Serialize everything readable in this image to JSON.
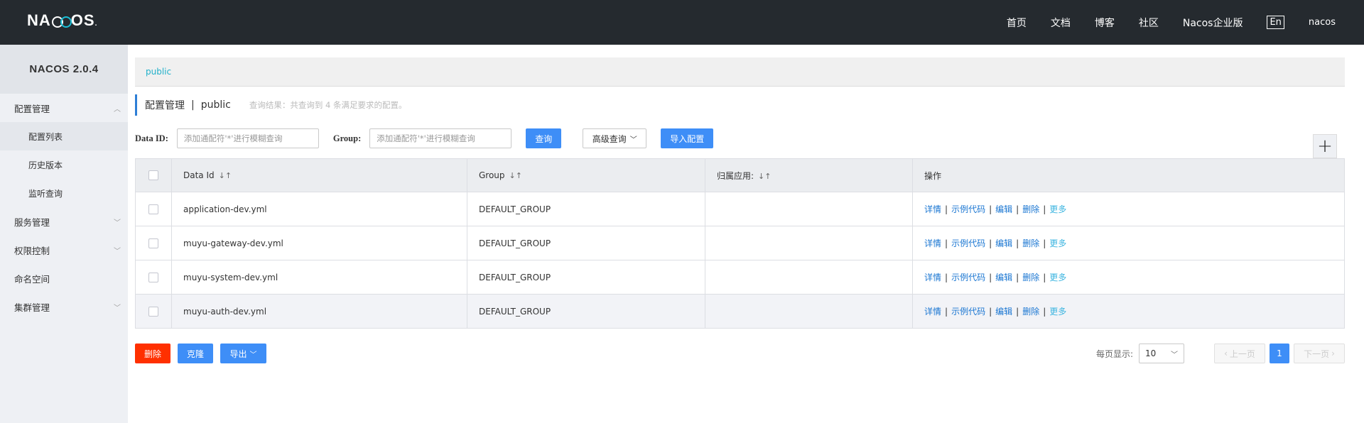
{
  "header": {
    "logo": "NACOS",
    "nav": [
      "首页",
      "文档",
      "博客",
      "社区",
      "Nacos企业版"
    ],
    "lang": "En",
    "user": "nacos"
  },
  "sidebar": {
    "version": "NACOS 2.0.4",
    "items": [
      {
        "label": "配置管理",
        "expanded": true
      },
      {
        "label": "配置列表",
        "sub": true,
        "active": true
      },
      {
        "label": "历史版本",
        "sub": true
      },
      {
        "label": "监听查询",
        "sub": true
      },
      {
        "label": "服务管理",
        "expanded": false
      },
      {
        "label": "权限控制",
        "expanded": false
      },
      {
        "label": "命名空间"
      },
      {
        "label": "集群管理",
        "expanded": false
      }
    ]
  },
  "main": {
    "namespace": "public",
    "title": "配置管理",
    "title_ns": "public",
    "result_hint": "查询结果：共查询到 4 条满足要求的配置。",
    "search": {
      "dataid_label": "Data ID:",
      "dataid_placeholder": "添加通配符'*'进行模糊查询",
      "group_label": "Group:",
      "group_placeholder": "添加通配符'*'进行模糊查询",
      "query_btn": "查询",
      "advanced_btn": "高级查询",
      "import_btn": "导入配置"
    },
    "table": {
      "headers": [
        "Data Id",
        "Group",
        "归属应用:",
        "操作"
      ],
      "rows": [
        {
          "dataid": "application-dev.yml",
          "group": "DEFAULT_GROUP",
          "app": ""
        },
        {
          "dataid": "muyu-gateway-dev.yml",
          "group": "DEFAULT_GROUP",
          "app": ""
        },
        {
          "dataid": "muyu-system-dev.yml",
          "group": "DEFAULT_GROUP",
          "app": ""
        },
        {
          "dataid": "muyu-auth-dev.yml",
          "group": "DEFAULT_GROUP",
          "app": ""
        }
      ],
      "ops": [
        "详情",
        "示例代码",
        "编辑",
        "删除",
        "更多"
      ]
    },
    "bottom": {
      "delete_btn": "删除",
      "clone_btn": "克隆",
      "export_btn": "导出",
      "page_size_label": "每页显示:",
      "page_size": "10",
      "prev": "上一页",
      "current_page": "1",
      "next": "下一页"
    }
  },
  "colors": {
    "header_bg": "#252a2f",
    "sidebar_bg": "#eef0f4",
    "primary": "#3e8ef7",
    "danger": "#ff3000",
    "link": "#1a76d2",
    "accent": "#21b1ca"
  }
}
